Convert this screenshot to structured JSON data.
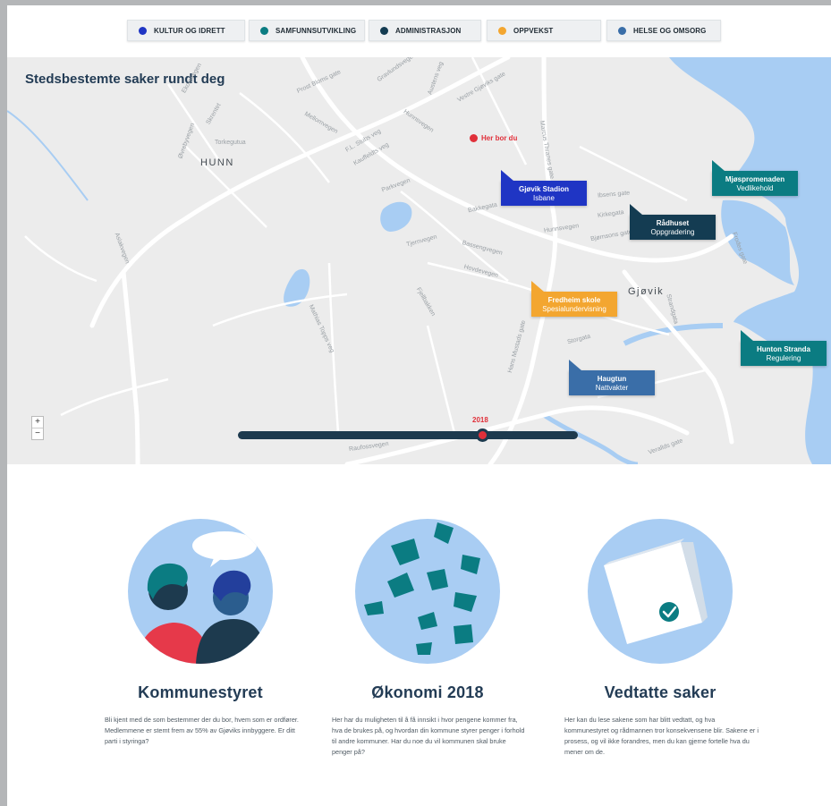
{
  "categories": [
    {
      "label": "KULTUR OG IDRETT",
      "color": "#1f35c4"
    },
    {
      "label": "SAMFUNNSUTVIKLING",
      "color": "#0b7c82"
    },
    {
      "label": "ADMINISTRASJON",
      "color": "#143c52"
    },
    {
      "label": "OPPVEKST",
      "color": "#f3a630"
    },
    {
      "label": "HELSE OG OMSORG",
      "color": "#3a6ea8"
    }
  ],
  "map": {
    "title": "Stedsbestemte saker rundt deg",
    "here_label": "Her bor du",
    "places": [
      "HUNN",
      "Gjøvik"
    ],
    "street_labels": [
      "Prost Bloms gate",
      "Kirkegata",
      "Bakkegata",
      "Parkvegen",
      "Tjernvegen",
      "Hunnsvegen",
      "Bjørnsons gate",
      "Ibsens gate",
      "Storgata",
      "Marcus Thranes gate",
      "Hans Mustads gate",
      "Mathias Topps veg",
      "Raufossvegen",
      "Øvrebyvegen",
      "Ekornvegen",
      "Skrentet",
      "Torkegutua",
      "Mellomvegen",
      "Hovdevegen",
      "Bassengvegen",
      "Vestre Gjøviks gate",
      "Aslakvegen",
      "Verallds gate",
      "Strandgata",
      "Kauffeldts veg",
      "F.L. Stubs veg",
      "Frodes gate",
      "Hunnsvegen",
      "Gravlundsvegen",
      "Austens veg",
      "Fjellbakken"
    ],
    "zoom_in": "+",
    "zoom_out": "−",
    "year": "2018",
    "pins": [
      {
        "title": "Gjøvik Stadion",
        "subtitle": "Isbane",
        "color": "#1f35c4"
      },
      {
        "title": "Mjøspromenaden",
        "subtitle": "Vedlikehold",
        "color": "#0b7c82"
      },
      {
        "title": "Rådhuset",
        "subtitle": "Oppgradering",
        "color": "#143c52"
      },
      {
        "title": "Fredheim skole",
        "subtitle": "Spesialundervisning",
        "color": "#f3a630"
      },
      {
        "title": "Hunton Stranda",
        "subtitle": "Regulering",
        "color": "#0b7c82"
      },
      {
        "title": "Haugtun",
        "subtitle": "Nattvakter",
        "color": "#3a6ea8"
      }
    ]
  },
  "cards": [
    {
      "title": "Kommunestyret",
      "text": "Bli kjent med de som bestemmer der du bor, hvem som er ordfører. Medlemmene er stemt frem av 55% av Gjøviks innbyggere. Er ditt parti i styringa?"
    },
    {
      "title": "Økonomi 2018",
      "text": "Her har du muligheten til å få innsikt i hvor pengene kommer fra, hva de brukes på, og hvordan din kommune styrer penger i forhold til andre kommuner. Har du noe du vil kommunen skal bruke penger på?"
    },
    {
      "title": "Vedtatte saker",
      "text": "Her kan du lese sakene som har blitt vedtatt, og hva kommunestyret og rådmannen tror konsekvensene blir. Sakene er i prosess, og vil ikke forandres, men du kan gjerne fortelle hva du mener om de."
    }
  ]
}
